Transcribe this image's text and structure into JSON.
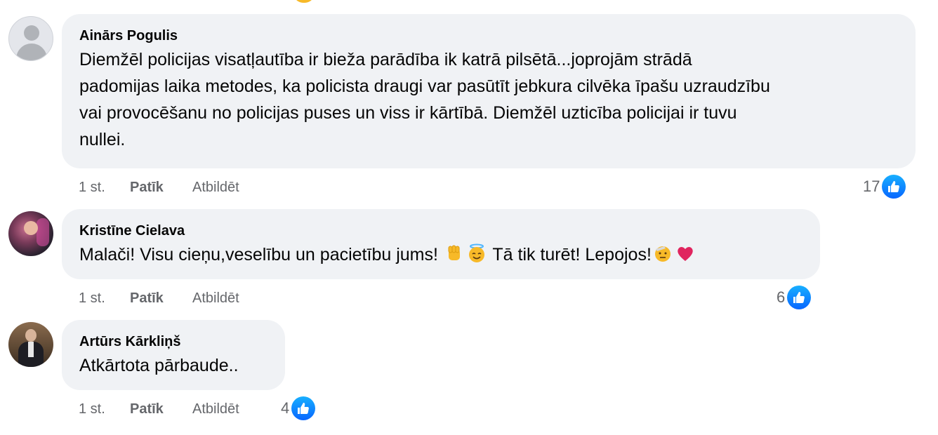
{
  "comments": [
    {
      "author": "Ainārs Pogulis",
      "text_lines": [
        "Diemžēl policijas visatļautība ir bieža parādība ik katrā pilsētā...joprojām strādā",
        "padomijas laika metodes, ka policista draugi var pasūtīt jebkura cilvēka īpašu uzraudzību",
        "vai provocēšanu no policijas puses un viss ir kārtībā. Diemžēl uzticība policijai ir tuvu",
        "nullei."
      ],
      "time": "1 st.",
      "like_label": "Patīk",
      "reply_label": "Atbildēt",
      "reaction_count": "17",
      "reaction_icon": "like-icon"
    },
    {
      "author": "Kristīne Cielava",
      "text_part1": "Malači! Visu cieņu,veselību un pacietību jums!",
      "text_part2": "Tā tik turēt! Lepojos!",
      "emojis": [
        "raised-fist-emoji",
        "smiling-face-with-halo-emoji",
        "saluting-face-emoji",
        "red-heart-emoji"
      ],
      "time": "1 st.",
      "like_label": "Patīk",
      "reply_label": "Atbildēt",
      "reaction_count": "6",
      "reaction_icon": "like-icon"
    },
    {
      "author": "Artūrs Kārkliņš",
      "text": "Atkārtota pārbaude..",
      "time": "1 st.",
      "like_label": "Patīk",
      "reply_label": "Atbildēt",
      "reaction_count": "4",
      "reaction_icon": "like-icon"
    }
  ],
  "colors": {
    "bubble": "#f0f2f5",
    "secondary_text": "#65676b",
    "like_blue": "#0866ff"
  }
}
